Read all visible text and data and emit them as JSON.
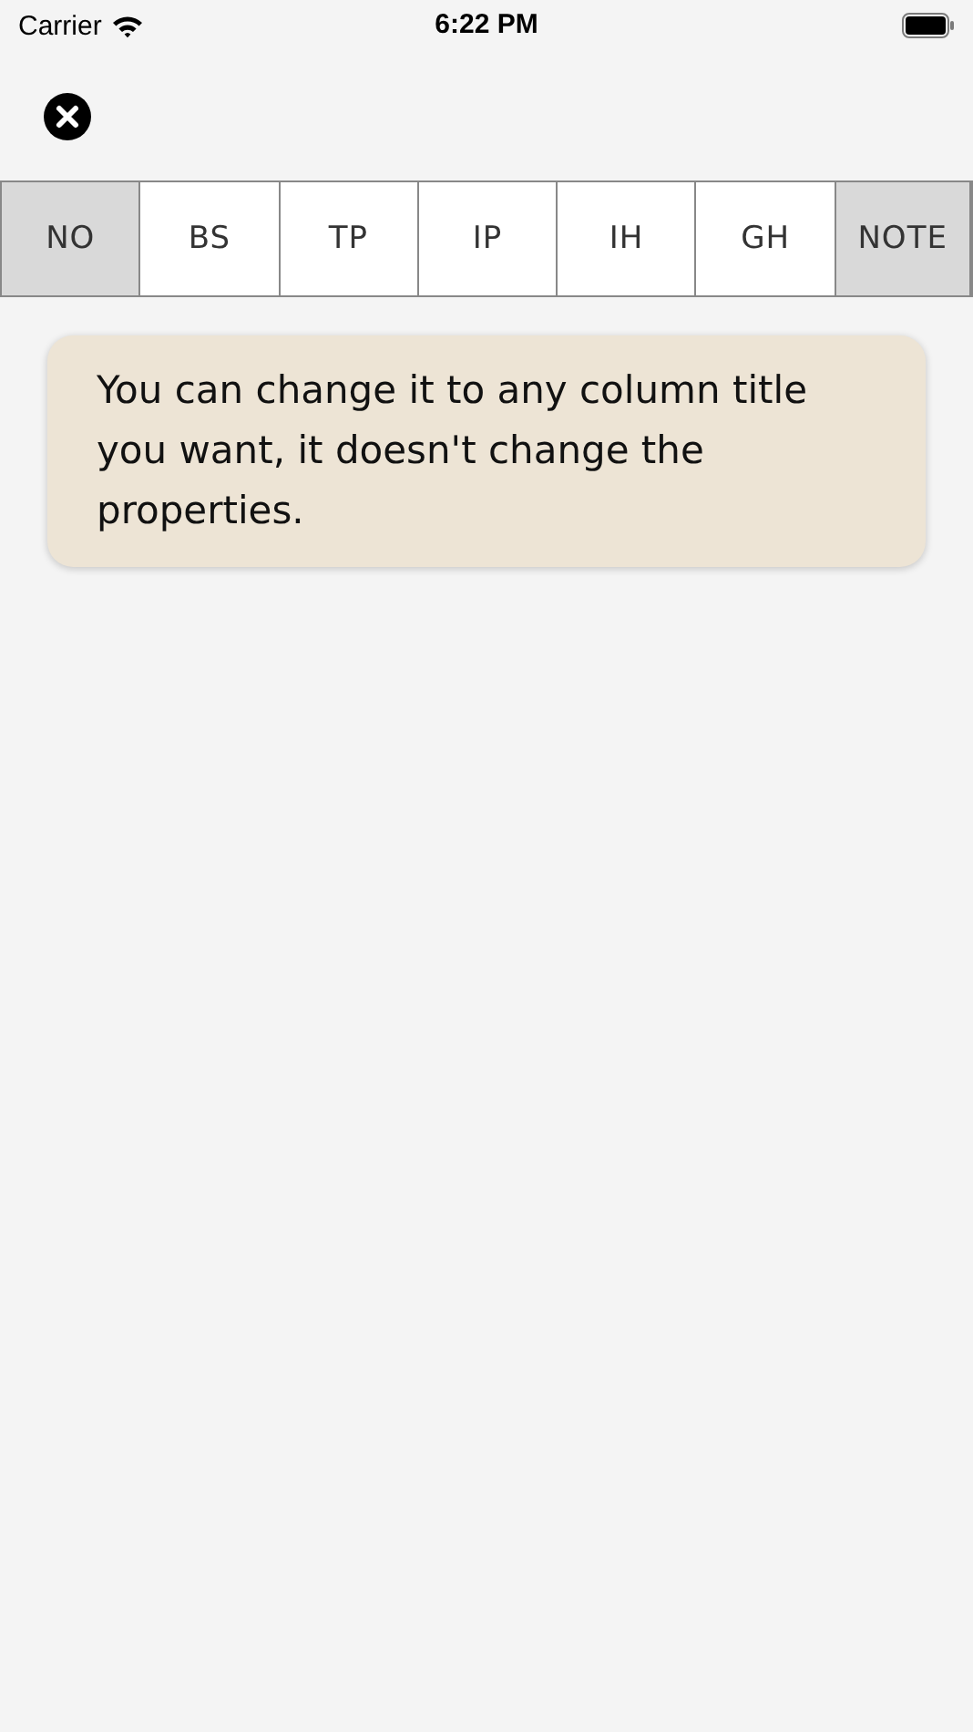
{
  "status_bar": {
    "carrier": "Carrier",
    "time": "6:22 PM"
  },
  "columns": [
    {
      "label": "NO",
      "highlighted": true
    },
    {
      "label": "BS",
      "highlighted": false
    },
    {
      "label": "TP",
      "highlighted": false
    },
    {
      "label": "IP",
      "highlighted": false
    },
    {
      "label": "IH",
      "highlighted": false
    },
    {
      "label": "GH",
      "highlighted": false
    },
    {
      "label": "NOTE",
      "highlighted": true
    }
  ],
  "tip": {
    "text": "You can change it to any column title you want, it doesn't change the properties."
  }
}
